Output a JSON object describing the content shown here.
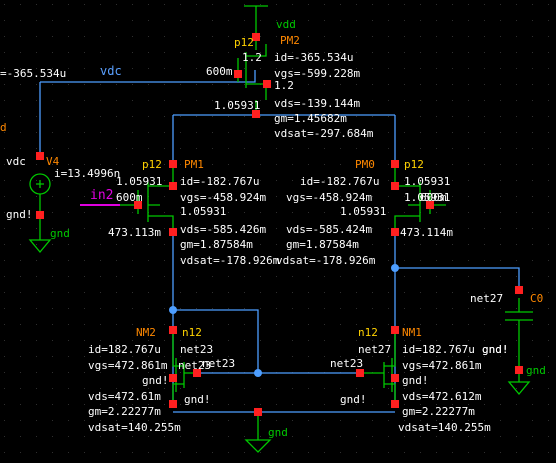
{
  "colors": {
    "background": "#000000",
    "wire": "#4d9eff",
    "device": "#00c800",
    "instance": "#ff8800",
    "annotation": "#ffffff",
    "node_text": "#ffd200",
    "pin": "#ff2020",
    "input_net": "#e000e0"
  },
  "icons": {
    "pin_marker": "red-square-pin-icon",
    "junction": "wire-junction-dot-icon",
    "ground": "ground-symbol-icon",
    "vsource": "voltage-source-icon",
    "capacitor": "capacitor-symbol-icon"
  },
  "left_edge": {
    "current": "=-365.534u",
    "partial": "d"
  },
  "vdd": {
    "label": "vdd"
  },
  "pm2": {
    "type": "p12",
    "name": "PM2",
    "width": "1.2",
    "width2": "1.2",
    "length": "600m",
    "node": "1.05931",
    "id": "id=-365.534u",
    "vgs": "vgs=-599.228m",
    "vds": "vds=-139.144m",
    "gm": "gm=1.45682m",
    "vdsat": "vdsat=-297.684m"
  },
  "vdc_net": {
    "label": "vdc"
  },
  "v4": {
    "type": "vdc",
    "name": "V4",
    "current": "i=13.4996n",
    "gnd": "gnd!",
    "gnd_label": "gnd"
  },
  "pm1": {
    "type": "p12",
    "name": "PM1",
    "node": "1.05931",
    "node2": "1.05931",
    "length": "600m",
    "drain": "473.113m",
    "id": "id=-182.767u",
    "vgs": "vgs=-458.924m",
    "vds": "vds=-585.426m",
    "gm": "gm=1.87584m",
    "vdsat": "vdsat=-178.926m"
  },
  "in2": {
    "label": "in2"
  },
  "pm0": {
    "type": "p12",
    "name": "PM0",
    "node": "1.05931",
    "node2": "1.05931",
    "node3": "1.05931",
    "length": "600m",
    "drain": "473.114m",
    "id": "id=-182.767u",
    "vgs": "vgs=-458.924m",
    "vds": "vds=-585.424m",
    "gm": "gm=1.87584m",
    "vdsat": "vdsat=-178.926m"
  },
  "c0": {
    "name": "C0",
    "net": "net27",
    "gnd": "gnd!",
    "gnd_label": "gnd"
  },
  "nm2": {
    "type": "n12",
    "name": "NM2",
    "net": "net23",
    "gate_net": "net23",
    "id": "id=182.767u",
    "vgs": "vgs=472.861m",
    "vds": "vds=472.61m",
    "gm": "gm=2.22277m",
    "vdsat": "vdsat=140.255m",
    "gnd": "gnd!"
  },
  "mid_net": {
    "label": "net23"
  },
  "nm1": {
    "type": "n12",
    "name": "NM1",
    "net": "net27",
    "gate_net": "net23",
    "id": "id=182.767u",
    "vgs": "vgs=472.861m",
    "vds": "vds=472.612m",
    "gm": "gm=2.22277m",
    "vdsat": "vdsat=140.255m",
    "gnd": "gnd!"
  },
  "bottom_gnd": {
    "label": "gnd"
  }
}
